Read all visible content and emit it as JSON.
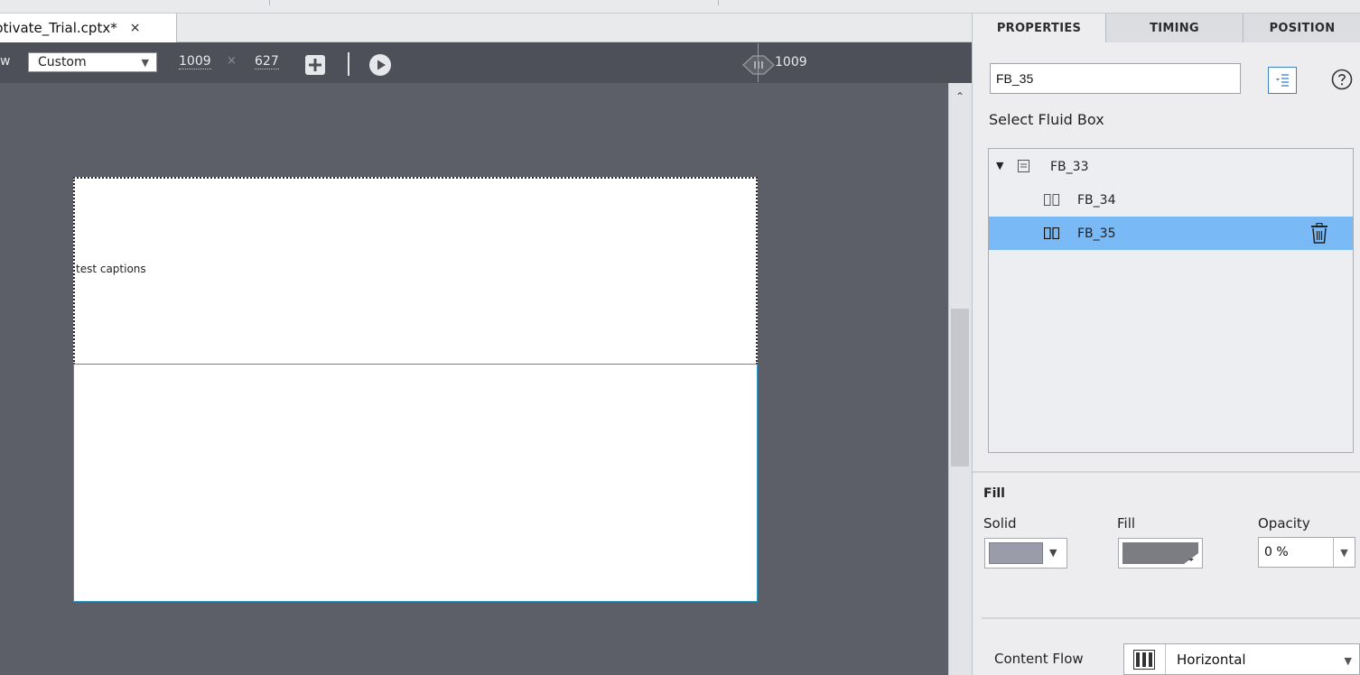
{
  "document": {
    "tab_name": "ptivate_Trial.cptx*",
    "close_glyph": "×"
  },
  "toolbar": {
    "view_label": "w",
    "preset_value": "Custom",
    "width_value": "1009",
    "separator": "×",
    "height_value": "627",
    "breakpoint_value": "1009"
  },
  "stage": {
    "caption_text": "test captions"
  },
  "panel": {
    "tabs": [
      {
        "label": "PROPERTIES",
        "active": true
      },
      {
        "label": "TIMING",
        "active": false
      },
      {
        "label": "POSITION",
        "active": false
      }
    ],
    "item_name": "FB_35",
    "fluid_box_title": "Select Fluid Box",
    "tree": [
      {
        "label": "FB_33",
        "icon": "vertical-box-icon",
        "level": 0,
        "expanded": true,
        "selected": false
      },
      {
        "label": "FB_34",
        "icon": "horizontal-box-icon",
        "level": 1,
        "selected": false
      },
      {
        "label": "FB_35",
        "icon": "horizontal-box-icon",
        "level": 1,
        "selected": true
      }
    ],
    "fill": {
      "title": "Fill",
      "solid_label": "Solid",
      "fill_label": "Fill",
      "opacity_label": "Opacity",
      "opacity_value": "0 %",
      "solid_color": "#9a9da9",
      "fill_color": "#7b7d83"
    },
    "content_flow": {
      "label": "Content Flow",
      "value": "Horizontal"
    }
  },
  "colors": {
    "stage_bg": "#5c5f67",
    "toolbar_bg": "#4d5058",
    "selection": "#79baf6",
    "accent_border": "#2d9ac6"
  }
}
